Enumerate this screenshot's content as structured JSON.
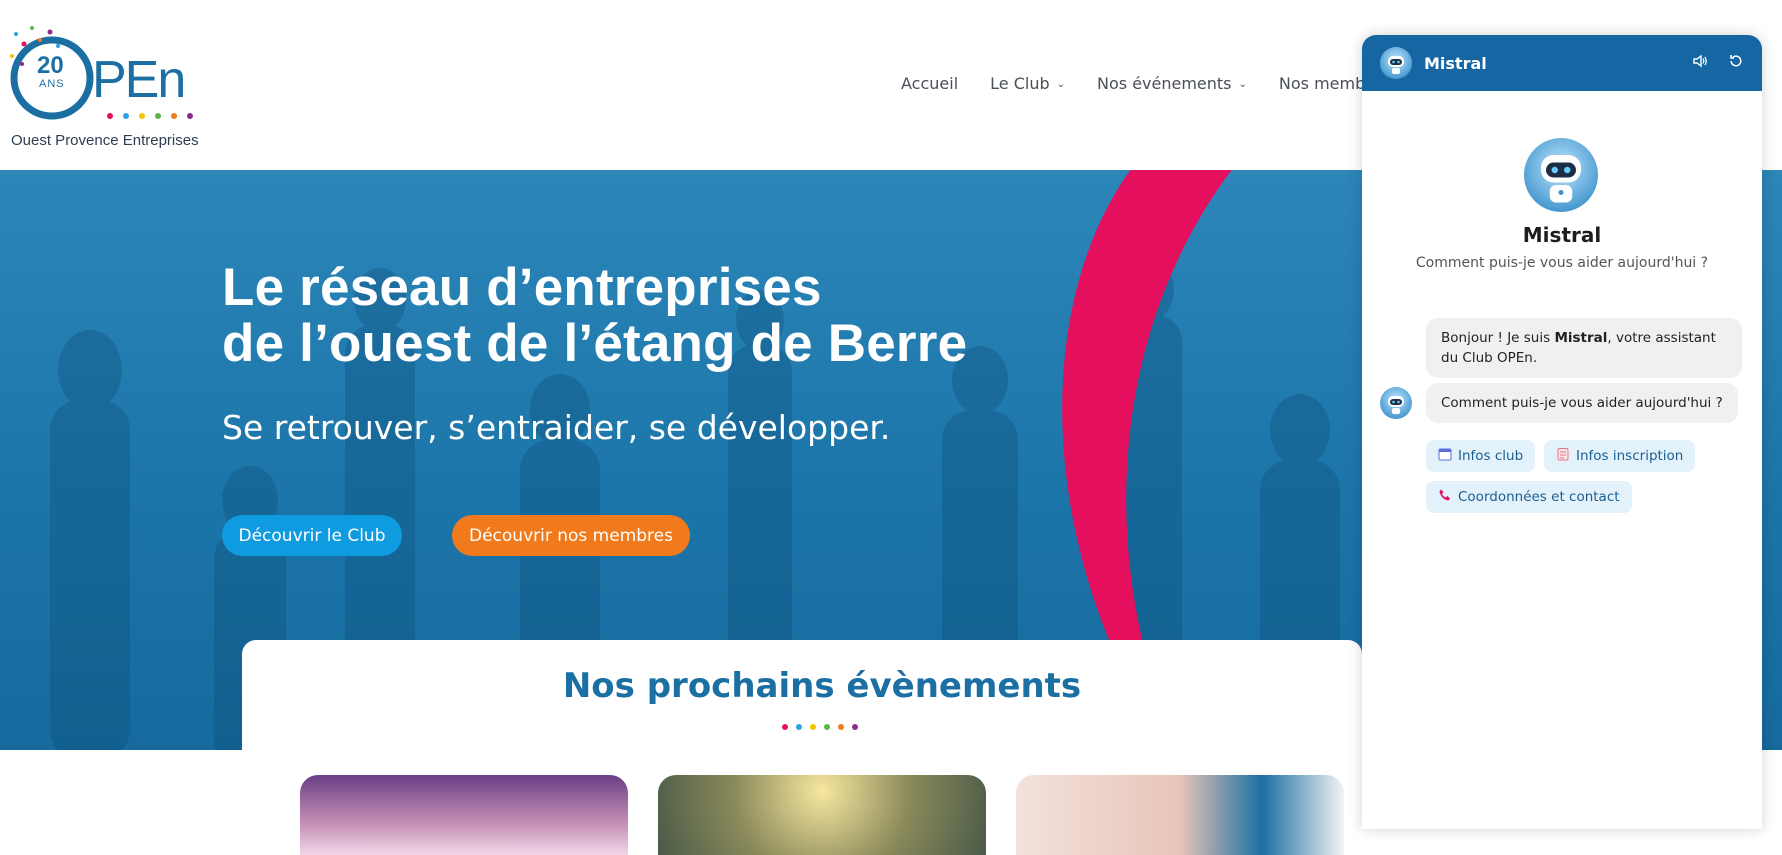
{
  "logo": {
    "years": "20",
    "years_unit": "ANS",
    "brand": "PEn",
    "subtitle": "Ouest Provence Entreprises"
  },
  "nav": {
    "items": [
      {
        "label": "Accueil",
        "has_dropdown": false
      },
      {
        "label": "Le Club",
        "has_dropdown": true
      },
      {
        "label": "Nos événements",
        "has_dropdown": true
      },
      {
        "label": "Nos memb",
        "has_dropdown": false
      }
    ]
  },
  "hero": {
    "title_line1": "Le réseau d’entreprises",
    "title_line2": "de l’ouest de l’étang de Berre",
    "subtitle": "Se retrouver, s’entraider, se développer.",
    "btn_club": "Découvrir le Club",
    "btn_membres": "Découvrir nos membres"
  },
  "events": {
    "title": "Nos prochains évènements"
  },
  "chat": {
    "header_name": "Mistral",
    "bot_name": "Mistral",
    "bot_help": "Comment puis-je vous aider aujourd'hui ?",
    "msg1_before": "Bonjour ! Je suis ",
    "msg1_bold": "Mistral",
    "msg1_after": ", votre assistant du Club OPEn.",
    "msg2": "Comment puis-je vous aider aujourd'hui ?",
    "chips": [
      {
        "icon": "calendar-icon",
        "label": "Infos club"
      },
      {
        "icon": "notepad-icon",
        "label": "Infos inscription"
      },
      {
        "icon": "phone-icon",
        "label": "Coordonnées et contact"
      }
    ]
  },
  "colors": {
    "primary_blue": "#1566a3",
    "accent_pink": "#e4105d",
    "orange": "#f07a1c",
    "light_blue": "#0f9be0"
  }
}
